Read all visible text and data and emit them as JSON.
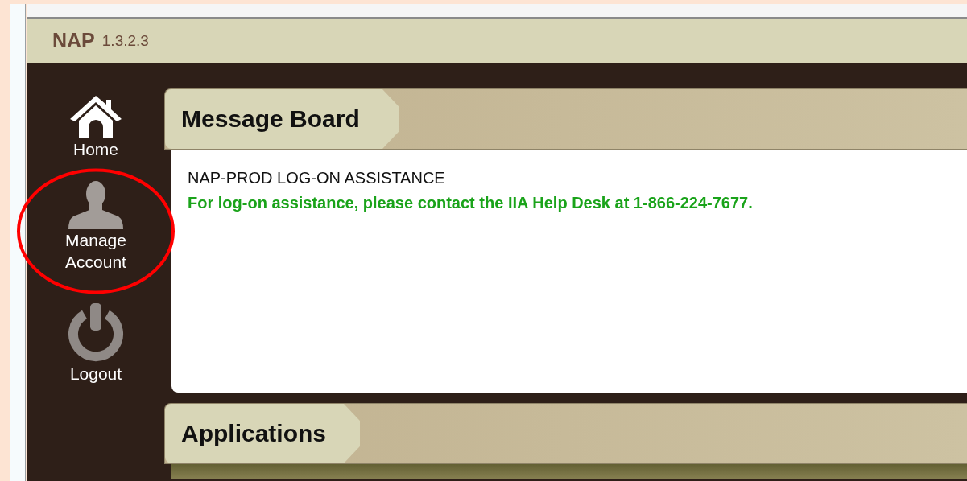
{
  "app": {
    "name": "NAP",
    "version": "1.3.2.3"
  },
  "nav": [
    {
      "kind": "home",
      "label": "Home",
      "circled": false
    },
    {
      "kind": "account",
      "label": "Manage\nAccount",
      "circled": true
    },
    {
      "kind": "logout",
      "label": "Logout",
      "circled": false
    }
  ],
  "message_board": {
    "title": "Message Board",
    "heading": "NAP-PROD LOG-ON ASSISTANCE",
    "body": "For log-on assistance, please contact the IIA Help Desk at 1-866-224-7677."
  },
  "applications": {
    "title": "Applications"
  }
}
